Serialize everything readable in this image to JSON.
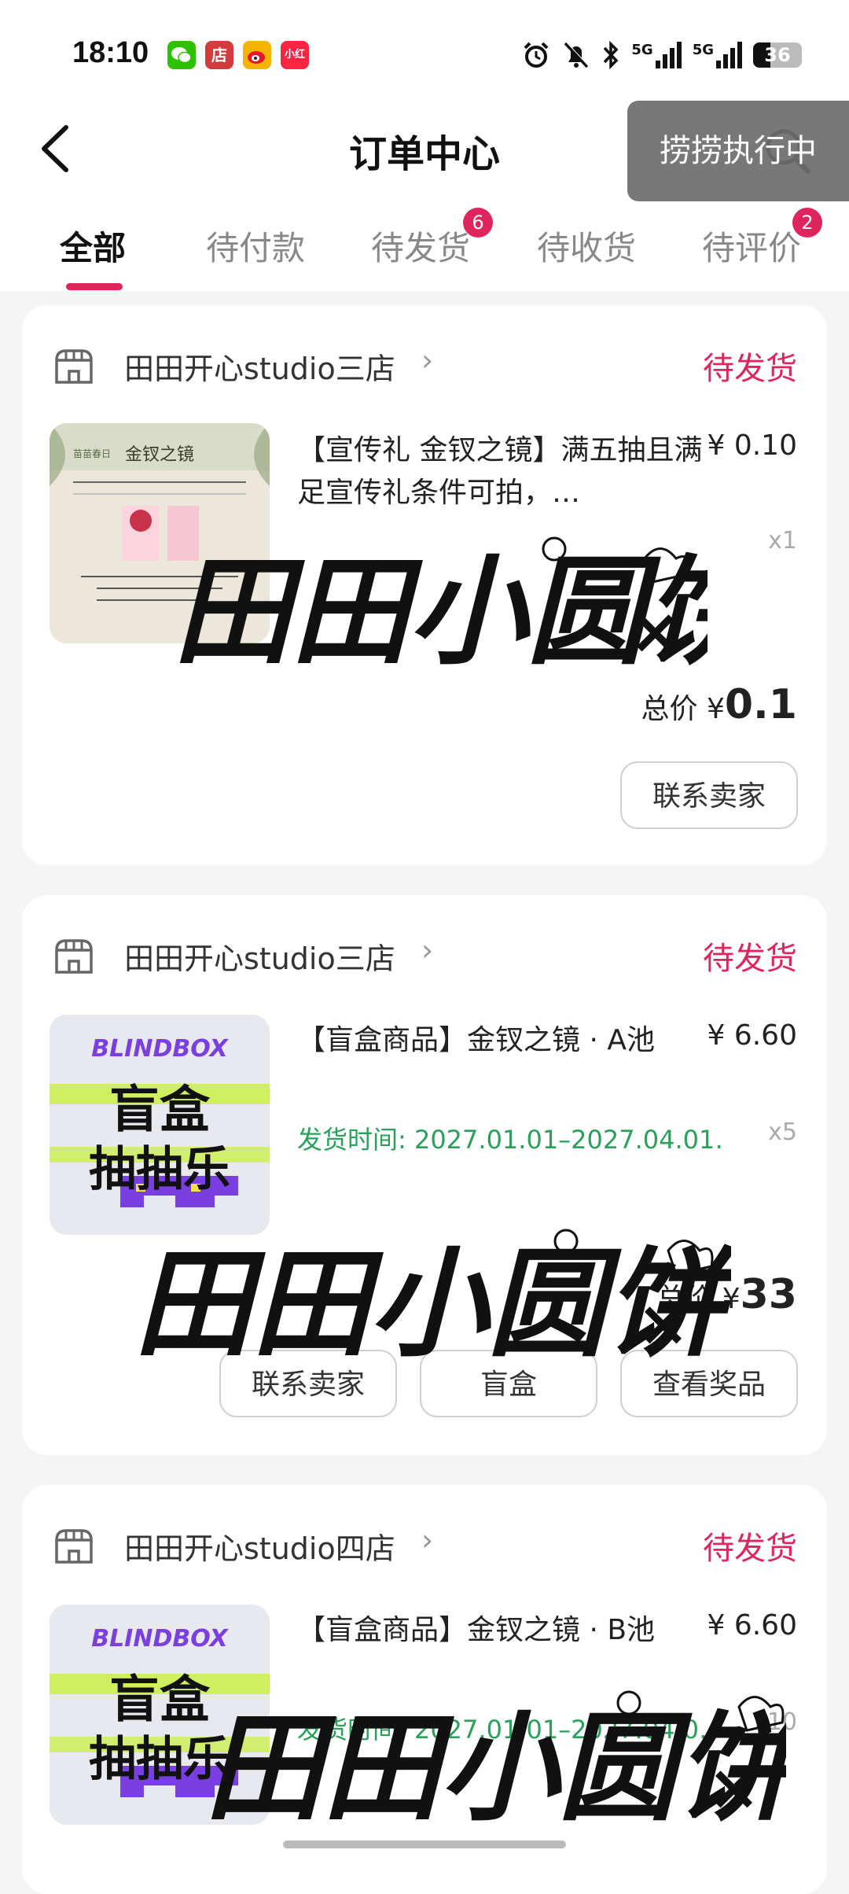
{
  "status_bar": {
    "time": "18:10",
    "apps": [
      {
        "name": "wechat-icon",
        "color": "#2dc100",
        "label": ""
      },
      {
        "name": "shop-app-icon",
        "color": "#d23c3c",
        "label": "店"
      },
      {
        "name": "weibo-icon",
        "color": "#f5b400",
        "label": ""
      },
      {
        "name": "xiaohongshu-icon",
        "color": "#ff2442",
        "label": "小红书"
      }
    ],
    "network1": "5G",
    "network2": "5G",
    "battery": "36"
  },
  "header": {
    "title": "订单中心",
    "toast": "捞捞执行中"
  },
  "tabs": [
    {
      "label": "全部"
    },
    {
      "label": "待付款"
    },
    {
      "label": "待发货",
      "badge": "6"
    },
    {
      "label": "待收货"
    },
    {
      "label": "待评价",
      "badge": "2"
    }
  ],
  "orders": [
    {
      "shop": "田田开心studio三店",
      "status": "待发货",
      "item_title": "【宣传礼 金钗之镜】满五抽且满足宣传礼条件可拍，…",
      "price": "¥ 0.10",
      "qty": "x1",
      "total_label": "总价",
      "total_currency": "¥",
      "total_value": "0.1",
      "buttons": [
        "联系卖家"
      ],
      "thumb": {
        "title": "金钗之镜",
        "brand": "苗苗春日"
      }
    },
    {
      "shop": "田田开心studio三店",
      "status": "待发货",
      "item_title": "【盲盒商品】金钗之镜 · A池",
      "ship_time": "发货时间: 2027.01.01–2027.04.01…",
      "price": "¥ 6.60",
      "qty": "x5",
      "total_label": "总价",
      "total_currency": "¥",
      "total_value": "33",
      "buttons": [
        "联系卖家",
        "盲盒",
        "查看奖品"
      ],
      "thumb": {
        "brand": "BLINDBOX",
        "line1": "盲盒",
        "line2": "抽抽乐"
      }
    },
    {
      "shop": "田田开心studio四店",
      "status": "待发货",
      "item_title": "【盲盒商品】金钗之镜 · B池",
      "ship_time": "发货时间: 2027.01.01–2027.04.0…",
      "price": "¥ 6.60",
      "qty": "x10",
      "thumb": {
        "brand": "BLINDBOX",
        "line1": "盲盒",
        "line2": "抽抽乐"
      }
    }
  ],
  "watermark": {
    "text": "田田小圆饼"
  },
  "colors": {
    "accent": "#e0245e",
    "ship_time": "#2aa05a"
  }
}
